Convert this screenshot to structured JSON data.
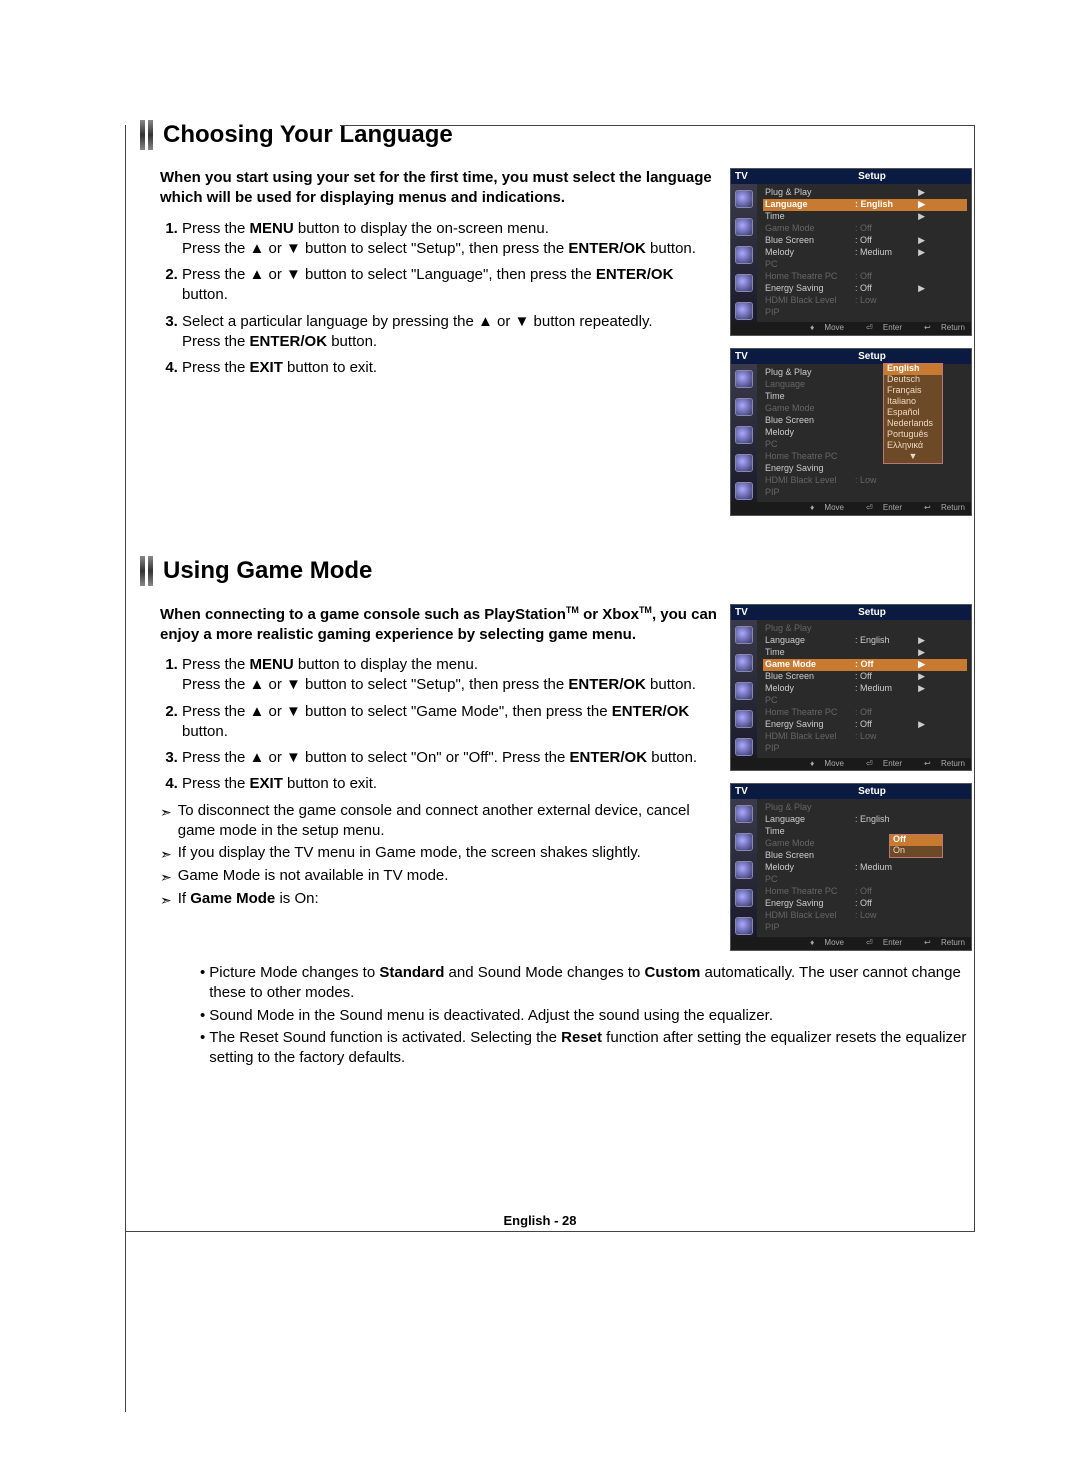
{
  "pageFooter": "English - 28",
  "section1": {
    "title": "Choosing Your Language",
    "intro": "When you start using your set for the first time, you must select the language which will be used for displaying menus and indications.",
    "step1a": "Press the ",
    "step1_menu": "MENU",
    "step1b": " button to display the on-screen menu.",
    "step1c": "Press the ▲ or ▼ button to select \"Setup\", then press the ",
    "step1_enter": "ENTER/OK",
    "step1d": " button.",
    "step2a": "Press the ▲ or ▼ button to select \"Language\", then press the ",
    "step2_enter": "ENTER/OK",
    "step2b": " button.",
    "step3a": "Select a particular language by pressing the ▲ or ▼ button repeatedly.",
    "step3b": "Press the ",
    "step3_enter": "ENTER/OK",
    "step3c": " button.",
    "step4a": "Press the ",
    "step4_exit": "EXIT",
    "step4b": " button to exit."
  },
  "section2": {
    "title": "Using Game Mode",
    "intro_a": "When connecting to a game console such as PlayStation",
    "intro_tm1": "TM",
    "intro_b": " or Xbox",
    "intro_tm2": "TM",
    "intro_c": ", you can enjoy a more realistic gaming experience by selecting game menu.",
    "step1a": "Press the ",
    "step1_menu": "MENU",
    "step1b": " button to display the menu.",
    "step1c": "Press the ▲ or ▼ button to select \"Setup\", then press the ",
    "step1_enter": "ENTER/OK",
    "step1d": " button.",
    "step2a": "Press the ▲ or ▼ button to select \"Game Mode\", then press the ",
    "step2_enter": "ENTER/OK",
    "step2b": " button.",
    "step3a": "Press the ▲ or ▼ button to select \"On\" or \"Off\". Press the ",
    "step3_enter": "ENTER/OK",
    "step3b": " button.",
    "step4a": "Press the ",
    "step4_exit": "EXIT",
    "step4b": " button to exit.",
    "note1": "To disconnect the game console and connect another external device, cancel game mode in the setup menu.",
    "note2": "If you display the TV menu in Game mode, the screen shakes slightly.",
    "note3": "Game Mode is not available in TV mode.",
    "note4a": "If ",
    "note4_bold": "Game Mode",
    "note4b": " is On:",
    "sub1a": "Picture Mode changes to ",
    "sub1_b1": "Standard",
    "sub1b": " and Sound Mode changes to ",
    "sub1_b2": "Custom",
    "sub1c": " automatically. The user cannot change these to other modes.",
    "sub2": "Sound Mode in the Sound menu is deactivated. Adjust the sound using the equalizer.",
    "sub3a": "The Reset Sound function is activated. Selecting the ",
    "sub3_b": "Reset",
    "sub3b": " function after setting the equalizer resets the equalizer setting to the factory defaults."
  },
  "osd": {
    "tv": "TV",
    "setup": "Setup",
    "plugplay": "Plug & Play",
    "language": "Language",
    "time": "Time",
    "gamemode": "Game Mode",
    "bluescreen": "Blue Screen",
    "melody": "Melody",
    "pc": "PC",
    "hometheatre": "Home Theatre PC",
    "energy": "Energy Saving",
    "hdmi": "HDMI Black Level",
    "pip": "PIP",
    "english": ": English",
    "off": ": Off",
    "medium": ": Medium",
    "low": ": Low",
    "on_val": "Off",
    "move": "Move",
    "enter": "Enter",
    "ret": "Return",
    "lang": {
      "english": "English",
      "deutsch": "Deutsch",
      "francais": "Français",
      "italiano": "Italiano",
      "espanol": "Español",
      "nederlands": "Nederlands",
      "portugues": "Português",
      "greek": "Ελληνικά"
    },
    "gm_opt_off": "Off",
    "gm_opt_on": "On"
  }
}
